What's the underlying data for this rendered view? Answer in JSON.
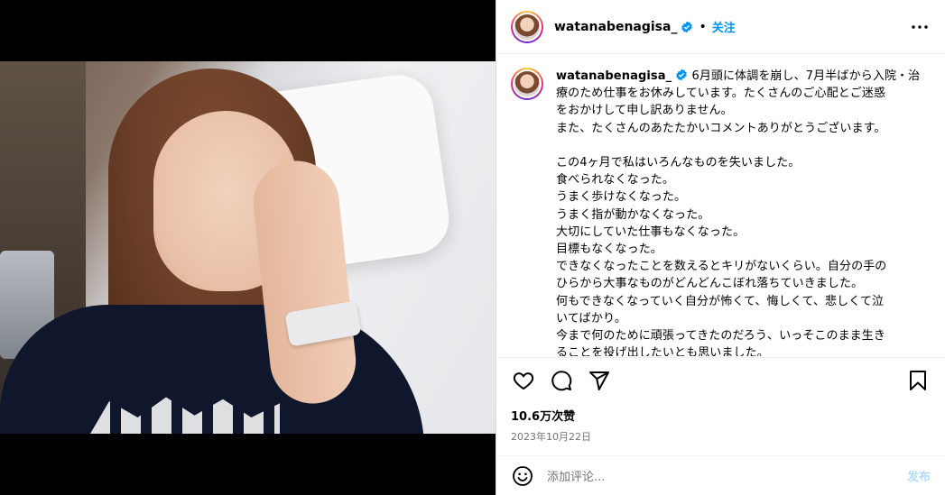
{
  "post": {
    "username": "watanabenagisa_",
    "dot": "•",
    "follow_label": "关注",
    "caption_lines": [
      "6月頭に体調を崩し、7月半ばから入院・治",
      "療のため仕事をお休みしています。たくさんのご心配とご迷惑",
      "をおかけして申し訳ありません。",
      "また、たくさんのあたたかいコメントありがとうございます。",
      "",
      "この4ヶ月で私はいろんなものを失いました。",
      "食べられなくなった。",
      "うまく歩けなくなった。",
      "うまく指が動かなくなった。",
      "大切にしていた仕事もなくなった。",
      "目標もなくなった。",
      "できなくなったことを数えるとキリがないくらい。自分の手の",
      "ひらから大事なものがどんどんこぼれ落ちていきました。",
      "何もできなくなっていく自分が怖くて、悔しくて、悲しくて泣",
      "いてばかり。",
      "今まで何のために頑張ってきたのだろう、いっそこのまま生き",
      "ることを投げ出したいとも思いました。"
    ],
    "likes": "10.6万次赞",
    "date": "2023年10月22日"
  },
  "comment": {
    "placeholder": "添加评论...",
    "post_label": "发布"
  },
  "colors": {
    "accent": "#0095f6",
    "verified": "#0095f6",
    "muted": "#737373"
  },
  "icons": [
    "more-icon",
    "heart-icon",
    "comment-icon",
    "share-icon",
    "bookmark-icon",
    "emoji-icon",
    "verified-icon"
  ]
}
